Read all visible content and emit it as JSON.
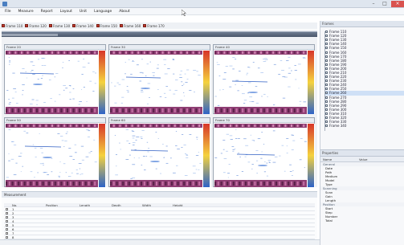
{
  "menubar": {
    "items": [
      "File",
      "Measure",
      "Report",
      "Layout",
      "Unit",
      "Language",
      "About"
    ]
  },
  "frame_tabs": [
    {
      "label": "Frame 110"
    },
    {
      "label": "Frame 120"
    },
    {
      "label": "Frame 130"
    },
    {
      "label": "Frame 140"
    },
    {
      "label": "Frame 150"
    },
    {
      "label": "Frame 160"
    },
    {
      "label": "Frame 170"
    }
  ],
  "panels": [
    {
      "title": "Frame 20"
    },
    {
      "title": "Frame 30"
    },
    {
      "title": "Frame 40"
    },
    {
      "title": "Frame 50"
    },
    {
      "title": "Frame 60"
    },
    {
      "title": "Frame 70"
    }
  ],
  "sidebar": {
    "title": "Frames",
    "tree_items": [
      "Frame 110",
      "Frame 120",
      "Frame 130",
      "Frame 140",
      "Frame 150",
      "Frame 160",
      "Frame 170",
      "Frame 180",
      "Frame 190",
      "Frame 200",
      "Frame 210",
      "Frame 220",
      "Frame 230",
      "Frame 240",
      "Frame 250",
      "Frame 260",
      "Frame 270",
      "Frame 280",
      "Frame 290",
      "Frame 300",
      "Frame 310",
      "Frame 320",
      "Frame 330",
      "Frame 340"
    ],
    "selected_index": 15
  },
  "properties": {
    "header": "Properties",
    "col_name": "Name",
    "col_value": "Value",
    "sections": [
      {
        "title": "General",
        "rows": [
          {
            "k": "Date",
            "v": ""
          },
          {
            "k": "Path",
            "v": ""
          },
          {
            "k": "Medium",
            "v": ""
          },
          {
            "k": "Model",
            "v": ""
          },
          {
            "k": "Type",
            "v": ""
          }
        ]
      },
      {
        "title": "Scanning",
        "rows": [
          {
            "k": "Scan",
            "v": ""
          },
          {
            "k": "Gain",
            "v": ""
          },
          {
            "k": "Length",
            "v": ""
          }
        ]
      },
      {
        "title": "Position",
        "rows": [
          {
            "k": "Start",
            "v": ""
          },
          {
            "k": "Step",
            "v": ""
          },
          {
            "k": "Number",
            "v": ""
          },
          {
            "k": "Total",
            "v": ""
          }
        ]
      }
    ]
  },
  "bottom": {
    "title": "Measurement",
    "table_header": [
      "No.",
      "Position",
      "Length",
      "Depth",
      "Width",
      "Height"
    ],
    "rows": [
      [
        "1",
        "",
        "",
        "",
        "",
        ""
      ],
      [
        "2",
        "",
        "",
        "",
        "",
        ""
      ],
      [
        "3",
        "",
        "",
        "",
        "",
        ""
      ],
      [
        "4",
        "",
        "",
        "",
        "",
        ""
      ],
      [
        "5",
        "",
        "",
        "",
        "",
        ""
      ],
      [
        "6",
        "",
        "",
        "",
        "",
        ""
      ],
      [
        "7",
        "",
        "",
        "",
        "",
        ""
      ],
      [
        "8",
        "",
        "",
        "",
        "",
        ""
      ]
    ]
  },
  "colors": {
    "titlebar": "#dfe6ef",
    "accent_red": "#c0392b",
    "band_purple": "#8f3f74",
    "colorbar_top": "#d7362a",
    "colorbar_mid": "#f5d23e",
    "colorbar_bottom": "#2e63c7"
  }
}
